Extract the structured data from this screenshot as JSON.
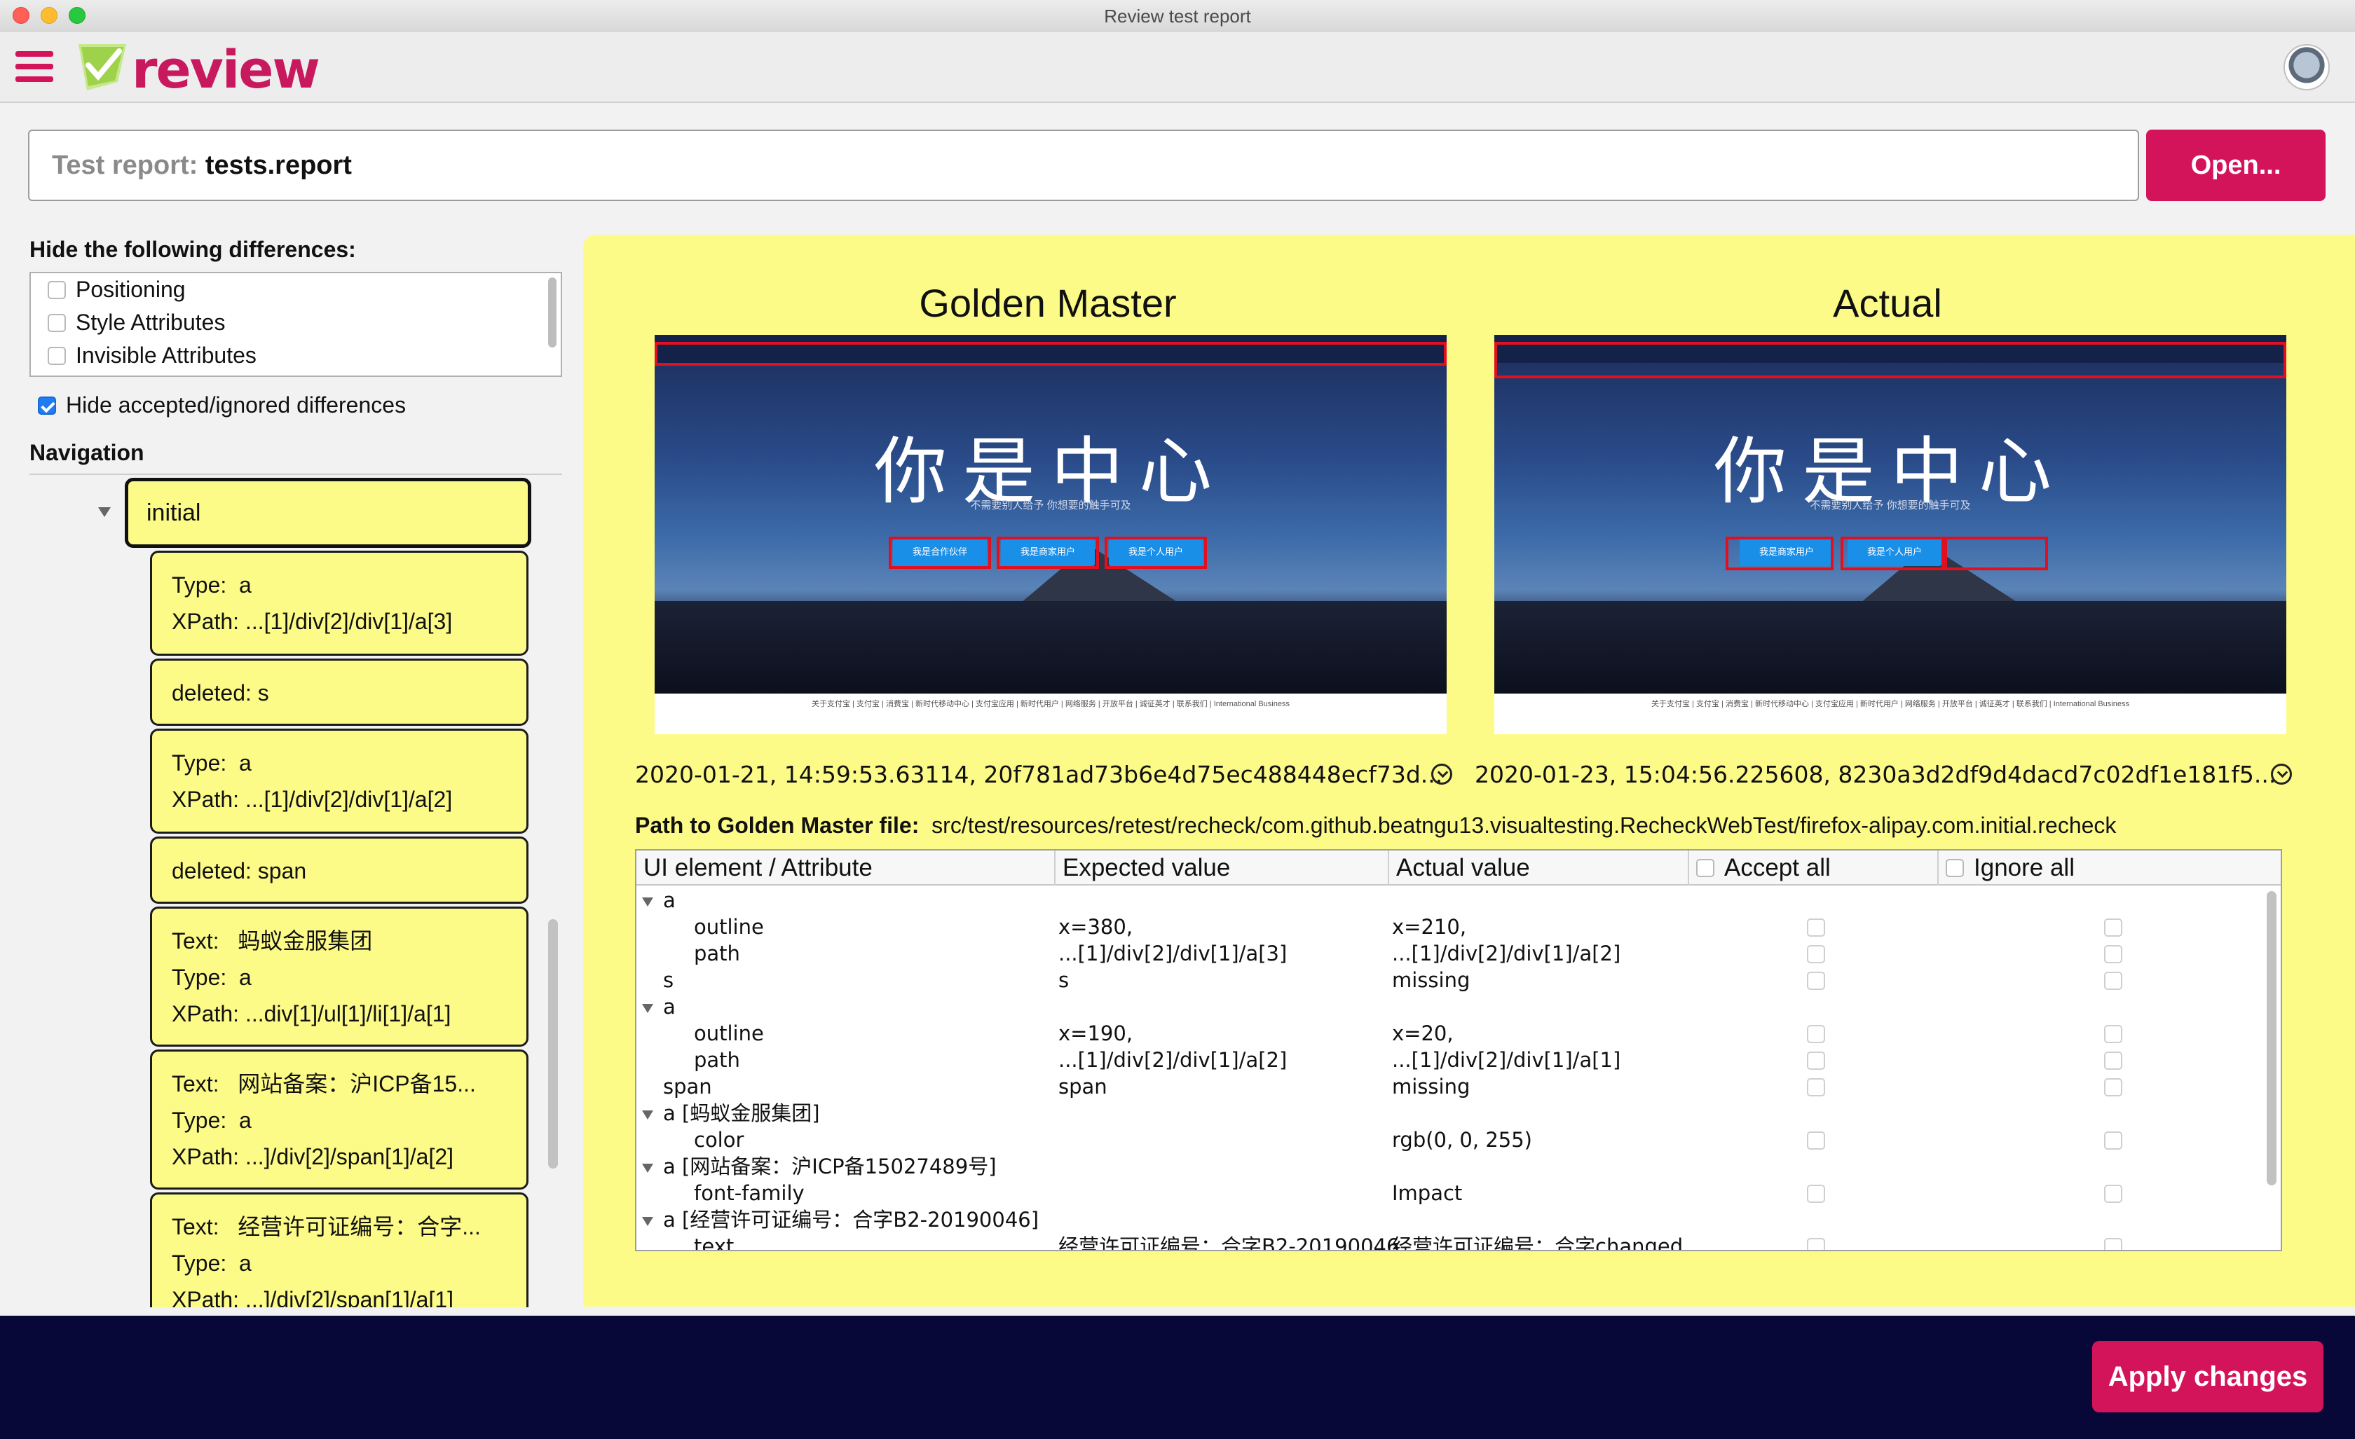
{
  "window": {
    "title": "Review test report"
  },
  "app": {
    "logo_text": "review",
    "brand_color": "#d4145a"
  },
  "report": {
    "label": "Test report:",
    "value": "tests.report",
    "open_label": "Open..."
  },
  "filters": {
    "title": "Hide the following differences:",
    "items": [
      "Positioning",
      "Style Attributes",
      "Invisible Attributes"
    ],
    "hide_accepted": "Hide accepted/ignored differences"
  },
  "navigation": {
    "title": "Navigation",
    "root": "initial",
    "items": [
      {
        "lines": [
          [
            "Type:",
            "a"
          ],
          [
            "XPath:",
            "...[1]/div[2]/div[1]/a[3]"
          ]
        ]
      },
      {
        "lines": [
          [
            "deleted: s",
            ""
          ]
        ]
      },
      {
        "lines": [
          [
            "Type:",
            "a"
          ],
          [
            "XPath:",
            "...[1]/div[2]/div[1]/a[2]"
          ]
        ]
      },
      {
        "lines": [
          [
            "deleted: span",
            ""
          ]
        ]
      },
      {
        "lines": [
          [
            "Text:",
            "蚂蚁金服集团"
          ],
          [
            "Type:",
            "a"
          ],
          [
            "XPath:",
            "...div[1]/ul[1]/li[1]/a[1]"
          ]
        ]
      },
      {
        "lines": [
          [
            "Text:",
            "网站备案：沪ICP备15..."
          ],
          [
            "Type:",
            "a"
          ],
          [
            "XPath:",
            "...]/div[2]/span[1]/a[2]"
          ]
        ]
      },
      {
        "lines": [
          [
            "Text:",
            "经营许可证编号：合字..."
          ],
          [
            "Type:",
            "a"
          ],
          [
            "XPath:",
            "...]/div[2]/span[1]/a[1]"
          ]
        ]
      }
    ]
  },
  "compare": {
    "golden_title": "Golden Master",
    "actual_title": "Actual",
    "golden_meta": "2020-01-21, 14:59:53.63114, 20f781ad73b6e4d75ec488448ecf73d...",
    "actual_meta": "2020-01-23, 15:04:56.225608, 8230a3d2df9d4dacd7c02df1e181f5...",
    "screenshot": {
      "calligraphy": "你是中心",
      "subtitle": "不需要别人给予  你想要的触手可及",
      "buttons_golden": [
        "我是合作伙伴",
        "我是商家用户",
        "我是个人用户"
      ],
      "buttons_actual": [
        "我是商家用户",
        "我是个人用户"
      ],
      "footer": "关于支付宝 | 支付宝 | 消费宝 | 新时代移动中心 | 支付宝应用 | 新时代用户 | 网络服务 | 开放平台 | 诚征英才 | 联系我们 | International Business"
    },
    "path_label": "Path to Golden Master file:",
    "path_value": "src/test/resources/retest/recheck/com.github.beatngu13.visualtesting.RecheckWebTest/firefox-alipay.com.initial.recheck"
  },
  "table": {
    "headers": {
      "element": "UI element / Attribute",
      "expected": "Expected value",
      "actual": "Actual value",
      "accept": "Accept all",
      "ignore": "Ignore all"
    },
    "rows": [
      {
        "kind": "group",
        "label": "a",
        "expected": "",
        "actual": ""
      },
      {
        "kind": "attr",
        "label": "outline",
        "expected": "x=380,",
        "actual": "x=210,"
      },
      {
        "kind": "attr",
        "label": "path",
        "expected": "...[1]/div[2]/div[1]/a[3]",
        "actual": "...[1]/div[2]/div[1]/a[2]"
      },
      {
        "kind": "leaf",
        "label": "s",
        "expected": "s",
        "actual": "missing"
      },
      {
        "kind": "group",
        "label": "a",
        "expected": "",
        "actual": ""
      },
      {
        "kind": "attr",
        "label": "outline",
        "expected": "x=190,",
        "actual": "x=20,"
      },
      {
        "kind": "attr",
        "label": "path",
        "expected": "...[1]/div[2]/div[1]/a[2]",
        "actual": "...[1]/div[2]/div[1]/a[1]"
      },
      {
        "kind": "leaf",
        "label": "span",
        "expected": "span",
        "actual": "missing"
      },
      {
        "kind": "group",
        "label": "a [蚂蚁金服集团]",
        "expected": "",
        "actual": ""
      },
      {
        "kind": "attr",
        "label": "color",
        "expected": "",
        "actual": "rgb(0, 0, 255)"
      },
      {
        "kind": "group",
        "label": "a [网站备案：沪ICP备15027489号]",
        "expected": "",
        "actual": ""
      },
      {
        "kind": "attr",
        "label": "font-family",
        "expected": "",
        "actual": "Impact"
      },
      {
        "kind": "group",
        "label": "a [经营许可证编号：合字B2-20190046]",
        "expected": "",
        "actual": ""
      },
      {
        "kind": "attr",
        "label": "text",
        "expected": "经营许可证编号：合字B2-20190046",
        "actual": "经营许可证编号：合字changed"
      }
    ]
  },
  "footer": {
    "apply_label": "Apply changes"
  }
}
